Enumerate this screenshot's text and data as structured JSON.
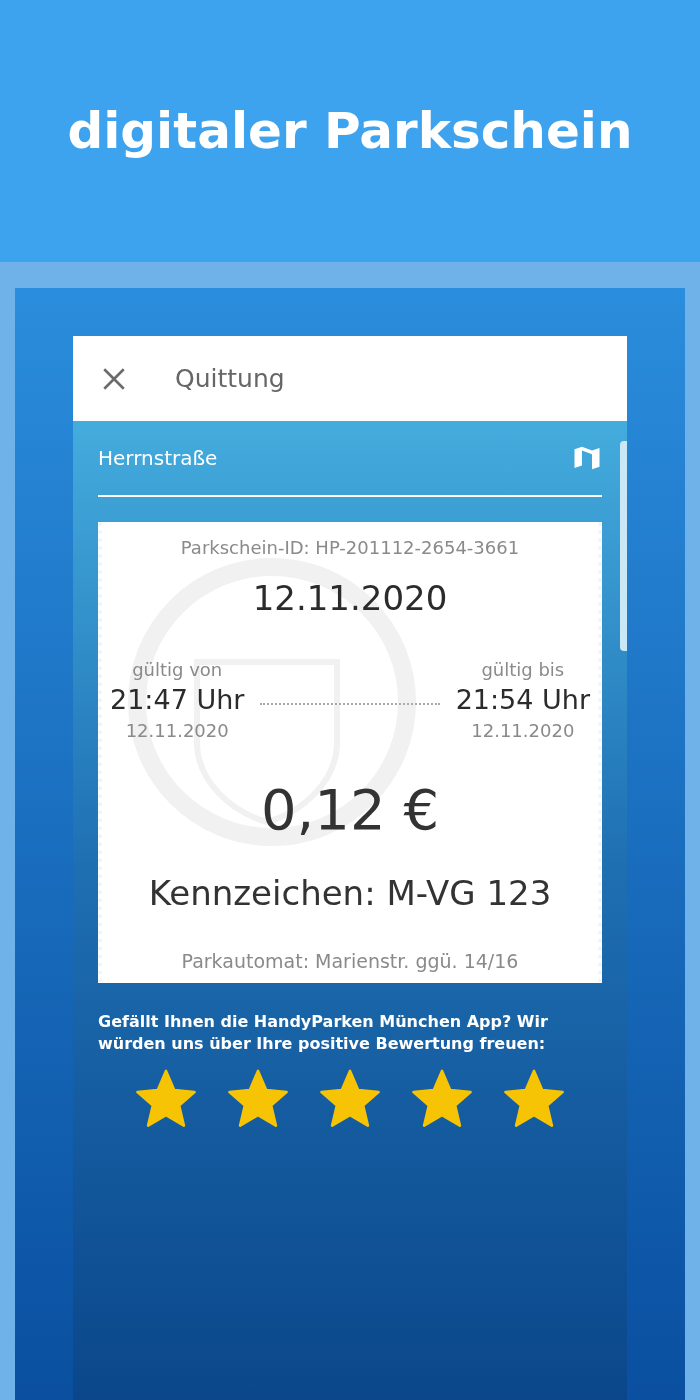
{
  "headline": "digitaler Parkschein",
  "app_bar": {
    "title": "Quittung"
  },
  "location": "Herrnstraße",
  "ticket": {
    "id": "Parkschein-ID: HP-201112-2654-3661",
    "date": "12.11.2020",
    "valid_from": {
      "label": "gültig von",
      "time": "21:47 Uhr",
      "date": "12.11.2020"
    },
    "valid_to": {
      "label": "gültig bis",
      "time": "21:54 Uhr",
      "date": "12.11.2020"
    },
    "price": "0,12 €",
    "plate": "Kennzeichen: M-VG 123",
    "machine": "Parkautomat: Marienstr. ggü. 14/16"
  },
  "rating": {
    "prompt": "Gefällt Ihnen die HandyParken München App? Wir würden uns über Ihre positive Bewertung freuen:",
    "stars": 5
  }
}
